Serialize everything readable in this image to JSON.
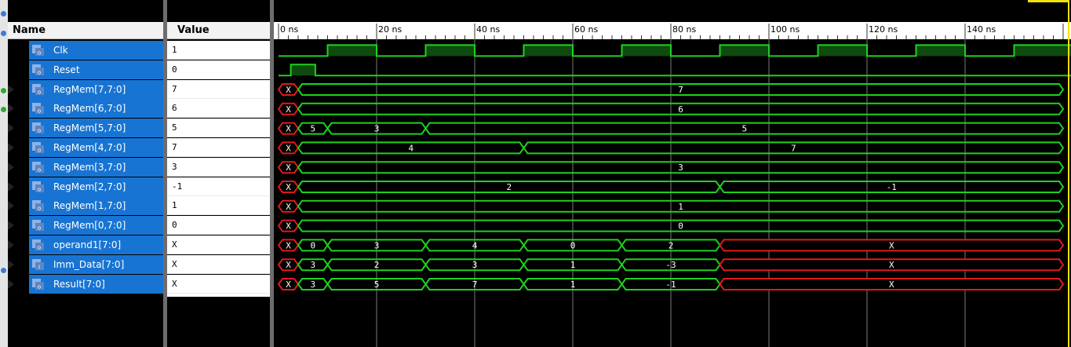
{
  "header": {
    "name_label": "Name",
    "value_label": "Value"
  },
  "signals": [
    {
      "name": "Clk",
      "value": "1",
      "expandable": false,
      "icon": "bit-signal-icon"
    },
    {
      "name": "Reset",
      "value": "0",
      "expandable": false,
      "icon": "bit-signal-icon"
    },
    {
      "name": "RegMem[7,7:0]",
      "value": "7",
      "expandable": true,
      "icon": "bus-signal-icon"
    },
    {
      "name": "RegMem[6,7:0]",
      "value": "6",
      "expandable": true,
      "icon": "bus-signal-icon"
    },
    {
      "name": "RegMem[5,7:0]",
      "value": "5",
      "expandable": true,
      "icon": "bus-signal-icon"
    },
    {
      "name": "RegMem[4,7:0]",
      "value": "7",
      "expandable": true,
      "icon": "bus-signal-icon"
    },
    {
      "name": "RegMem[3,7:0]",
      "value": "3",
      "expandable": true,
      "icon": "bus-signal-icon"
    },
    {
      "name": "RegMem[2,7:0]",
      "value": "-1",
      "expandable": true,
      "icon": "bus-signal-icon"
    },
    {
      "name": "RegMem[1,7:0]",
      "value": "1",
      "expandable": true,
      "icon": "bus-signal-icon"
    },
    {
      "name": "RegMem[0,7:0]",
      "value": "0",
      "expandable": true,
      "icon": "bus-signal-icon"
    },
    {
      "name": "operand1[7:0]",
      "value": "X",
      "expandable": true,
      "icon": "bus-signal-icon"
    },
    {
      "name": "Imm_Data[7:0]",
      "value": "X",
      "expandable": true,
      "icon": "bus-input-signal-icon"
    },
    {
      "name": "Result[7:0]",
      "value": "X",
      "expandable": true,
      "icon": "bus-signal-icon"
    }
  ],
  "timeline": {
    "range_ns": [
      0,
      150
    ],
    "major_step_ns": 20,
    "minor_step_ns": 2,
    "labels": [
      "0 ns",
      "20 ns",
      "40 ns",
      "60 ns",
      "80 ns",
      "100 ns",
      "120 ns",
      "140 ns"
    ]
  },
  "waveforms": [
    {
      "type": "bit",
      "initial": 0,
      "toggles_ns": [
        10,
        20,
        30,
        40,
        50,
        60,
        70,
        80,
        90,
        100,
        110,
        120,
        130,
        140,
        150
      ]
    },
    {
      "type": "bit",
      "initial": 0,
      "toggles_ns": [
        2.5,
        7.5
      ]
    },
    {
      "type": "bus",
      "segments": [
        {
          "start": 0,
          "end": 4,
          "label": "X",
          "x": true
        },
        {
          "start": 4,
          "end": 160,
          "label": "7"
        }
      ]
    },
    {
      "type": "bus",
      "segments": [
        {
          "start": 0,
          "end": 4,
          "label": "X",
          "x": true
        },
        {
          "start": 4,
          "end": 160,
          "label": "6"
        }
      ]
    },
    {
      "type": "bus",
      "segments": [
        {
          "start": 0,
          "end": 4,
          "label": "X",
          "x": true
        },
        {
          "start": 4,
          "end": 10,
          "label": "5"
        },
        {
          "start": 10,
          "end": 30,
          "label": "3"
        },
        {
          "start": 30,
          "end": 160,
          "label": "5"
        }
      ]
    },
    {
      "type": "bus",
      "segments": [
        {
          "start": 0,
          "end": 4,
          "label": "X",
          "x": true
        },
        {
          "start": 4,
          "end": 50,
          "label": "4"
        },
        {
          "start": 50,
          "end": 160,
          "label": "7"
        }
      ]
    },
    {
      "type": "bus",
      "segments": [
        {
          "start": 0,
          "end": 4,
          "label": "X",
          "x": true
        },
        {
          "start": 4,
          "end": 160,
          "label": "3"
        }
      ]
    },
    {
      "type": "bus",
      "segments": [
        {
          "start": 0,
          "end": 4,
          "label": "X",
          "x": true
        },
        {
          "start": 4,
          "end": 90,
          "label": "2"
        },
        {
          "start": 90,
          "end": 160,
          "label": "-1"
        }
      ]
    },
    {
      "type": "bus",
      "segments": [
        {
          "start": 0,
          "end": 4,
          "label": "X",
          "x": true
        },
        {
          "start": 4,
          "end": 160,
          "label": "1"
        }
      ]
    },
    {
      "type": "bus",
      "segments": [
        {
          "start": 0,
          "end": 4,
          "label": "X",
          "x": true
        },
        {
          "start": 4,
          "end": 160,
          "label": "0"
        }
      ]
    },
    {
      "type": "bus",
      "segments": [
        {
          "start": 0,
          "end": 4,
          "label": "X",
          "x": true
        },
        {
          "start": 4,
          "end": 10,
          "label": "0"
        },
        {
          "start": 10,
          "end": 30,
          "label": "3"
        },
        {
          "start": 30,
          "end": 50,
          "label": "4"
        },
        {
          "start": 50,
          "end": 70,
          "label": "0"
        },
        {
          "start": 70,
          "end": 90,
          "label": "2"
        },
        {
          "start": 90,
          "end": 160,
          "label": "X",
          "x": true
        }
      ]
    },
    {
      "type": "bus",
      "segments": [
        {
          "start": 0,
          "end": 4,
          "label": "X",
          "x": true
        },
        {
          "start": 4,
          "end": 10,
          "label": "3"
        },
        {
          "start": 10,
          "end": 30,
          "label": "2"
        },
        {
          "start": 30,
          "end": 50,
          "label": "3"
        },
        {
          "start": 50,
          "end": 70,
          "label": "1"
        },
        {
          "start": 70,
          "end": 90,
          "label": "-3"
        },
        {
          "start": 90,
          "end": 160,
          "label": "X",
          "x": true
        }
      ]
    },
    {
      "type": "bus",
      "segments": [
        {
          "start": 0,
          "end": 4,
          "label": "X",
          "x": true
        },
        {
          "start": 4,
          "end": 10,
          "label": "3"
        },
        {
          "start": 10,
          "end": 30,
          "label": "5"
        },
        {
          "start": 30,
          "end": 50,
          "label": "7"
        },
        {
          "start": 50,
          "end": 70,
          "label": "1"
        },
        {
          "start": 70,
          "end": 90,
          "label": "-1"
        },
        {
          "start": 90,
          "end": 160,
          "label": "X",
          "x": true
        }
      ]
    }
  ],
  "colors": {
    "wave": "#1ed21e",
    "wave_fill": "#0f4a0f",
    "undefined": "#e01b1b",
    "grid": "#7a7a7a",
    "selection": "#1874d3",
    "cursor": "#f2e200"
  }
}
